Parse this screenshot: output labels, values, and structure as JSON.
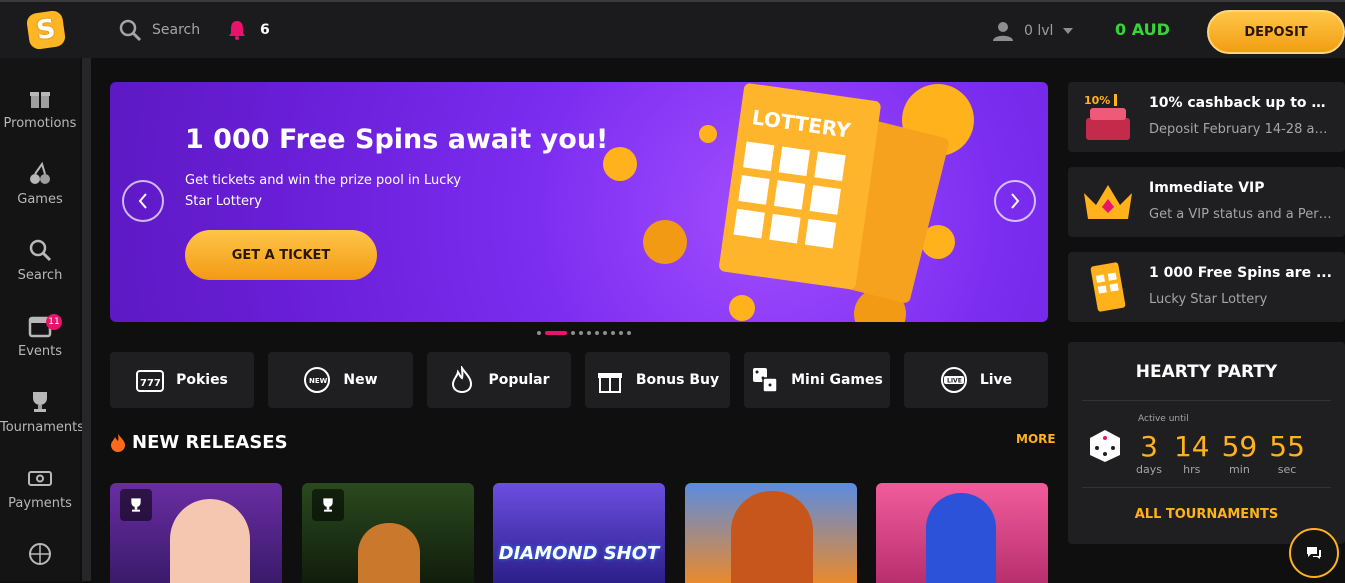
{
  "header": {
    "logo_letter": "S",
    "search_label": "Search",
    "notifications_count": "6",
    "user_level": "0 lvl",
    "balance": "0 AUD",
    "deposit_label": "DEPOSIT"
  },
  "sidebar": {
    "items": [
      {
        "label": "Promotions",
        "icon": "gift-icon"
      },
      {
        "label": "Games",
        "icon": "cherries-icon"
      },
      {
        "label": "Search",
        "icon": "search-icon"
      },
      {
        "label": "Events",
        "icon": "calendar-icon",
        "badge": "11"
      },
      {
        "label": "Tournaments",
        "icon": "trophy-icon"
      },
      {
        "label": "Payments",
        "icon": "payments-icon"
      },
      {
        "label": "",
        "icon": "ball-icon"
      }
    ]
  },
  "banner": {
    "title": "1 000 Free Spins await you!",
    "text": "Get tickets and win the prize pool in Lucky Star Lottery",
    "cta": "GET A TICKET",
    "ticket_word": "LOTTERY",
    "slides": 10,
    "active_slide": 2
  },
  "categories": [
    {
      "label": "Pokies",
      "icon": "slot-777-icon"
    },
    {
      "label": "New",
      "icon": "new-badge-icon"
    },
    {
      "label": "Popular",
      "icon": "fire-icon"
    },
    {
      "label": "Bonus Buy",
      "icon": "gift-box-icon"
    },
    {
      "label": "Mini Games",
      "icon": "dice-icon"
    },
    {
      "label": "Live",
      "icon": "live-icon"
    }
  ],
  "new_releases": {
    "title": "NEW RELEASES",
    "more": "MORE",
    "tiles": [
      {
        "name": "game-tile-1",
        "color": "#5b2a8a"
      },
      {
        "name": "game-tile-2",
        "color": "#1f3b1a"
      },
      {
        "name": "game-tile-3",
        "color": "#4a3fb8",
        "title": "DIAMOND SHOT"
      },
      {
        "name": "game-tile-4",
        "color": "#d96b1e"
      },
      {
        "name": "game-tile-5",
        "color": "#e24f86"
      }
    ]
  },
  "promos": [
    {
      "title": "10% cashback up to $...",
      "subtitle": "Deposit February 14-28 and ..."
    },
    {
      "title": "Immediate VIP",
      "subtitle": "Get a VIP status and a Perso..."
    },
    {
      "title": "1 000 Free Spins are ...",
      "subtitle": "Lucky Star Lottery"
    }
  ],
  "party": {
    "title": "HEARTY PARTY",
    "active_until": "Active until",
    "countdown": [
      {
        "value": "3",
        "unit": "days"
      },
      {
        "value": "14",
        "unit": "hrs"
      },
      {
        "value": "59",
        "unit": "min"
      },
      {
        "value": "55",
        "unit": "sec"
      }
    ],
    "all_tournaments": "ALL TOURNAMENTS"
  },
  "colors": {
    "accent": "#ffb21b",
    "balance": "#39d439",
    "badge": "#e8136a",
    "banner": "#7b2df0"
  }
}
